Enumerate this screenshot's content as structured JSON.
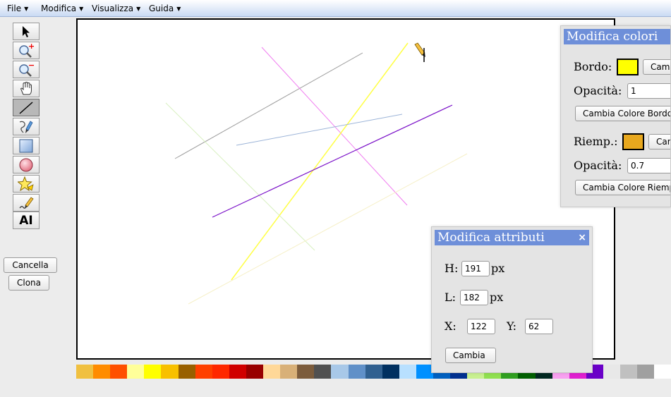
{
  "menu": [
    {
      "label": "File"
    },
    {
      "label": "Modifica"
    },
    {
      "label": "Visualizza"
    },
    {
      "label": "Guida"
    }
  ],
  "tools": [
    {
      "name": "select-tool",
      "icon": "arrow-pointer-icon"
    },
    {
      "name": "zoom-in-tool",
      "icon": "zoom-in-icon"
    },
    {
      "name": "zoom-out-tool",
      "icon": "zoom-out-icon"
    },
    {
      "name": "pan-tool",
      "icon": "hand-icon"
    },
    {
      "name": "line-tool",
      "icon": "line-icon",
      "active": true
    },
    {
      "name": "freehand-tool",
      "icon": "brush-icon"
    },
    {
      "name": "rectangle-tool",
      "icon": "rectangle-icon"
    },
    {
      "name": "circle-tool",
      "icon": "circle-icon"
    },
    {
      "name": "star-tool",
      "icon": "star-icon"
    },
    {
      "name": "pencil-tool",
      "icon": "pencil-icon"
    },
    {
      "name": "text-tool",
      "icon": "text-icon",
      "label": "AI"
    }
  ],
  "side_buttons": {
    "cancella": "Cancella",
    "clona": "Clona"
  },
  "canvas": {
    "lines": [
      {
        "color": "#9e9e9e"
      },
      {
        "color": "#f07cf0"
      },
      {
        "color": "#ffff44"
      },
      {
        "color": "#d8f0c0"
      },
      {
        "color": "#9cb4d8"
      },
      {
        "color": "#7a10c8"
      },
      {
        "color": "#f6f0c8"
      }
    ]
  },
  "panel_colori": {
    "title": "Modifica colori",
    "bordo_label": "Bordo:",
    "bordo_color": "#ffff00",
    "bordo_change_button": "Cambia",
    "opacita_bordo_label": "Opacità:",
    "opacita_bordo_value": "1",
    "cambia_bordo_button": "Cambia Colore Bordo",
    "riemp_label": "Riemp.:",
    "riemp_color": "#e8a81e",
    "riemp_change_button": "Cambia",
    "opacita_riemp_label": "Opacità:",
    "opacita_riemp_value": "0.7",
    "cambia_riemp_button": "Cambia Colore Riemp."
  },
  "panel_attributi": {
    "title": "Modifica attributi",
    "close": "×",
    "h_label": "H:",
    "h_value": "191",
    "h_unit": "px",
    "l_label": "L:",
    "l_value": "182",
    "l_unit": "px",
    "x_label": "X:",
    "x_value": "122",
    "y_label": "Y:",
    "y_value": "62",
    "cambia_button": "Cambia"
  },
  "palette": [
    "#f0c040",
    "#ff8c00",
    "#ff5000",
    "#ffff99",
    "#ffff00",
    "#f8c000",
    "#986000",
    "#ff4000",
    "#ff2800",
    "#d00000",
    "#980000",
    "#ffd898",
    "#d8b078",
    "#7c5c3c",
    "#505050",
    "#a8c8e8",
    "#6090c8",
    "#306090",
    "#003060",
    "#b8e0ff",
    "#0090ff",
    "#0060c0",
    "#003090",
    "#c8f090",
    "#90e050",
    "#30a020",
    "#006000",
    "#002820",
    "#f8a0f0",
    "#e020d0",
    "#6a00c8",
    "#e8e8e8",
    "#c0c0c0",
    "#a0a0a0",
    "#ffffff"
  ]
}
